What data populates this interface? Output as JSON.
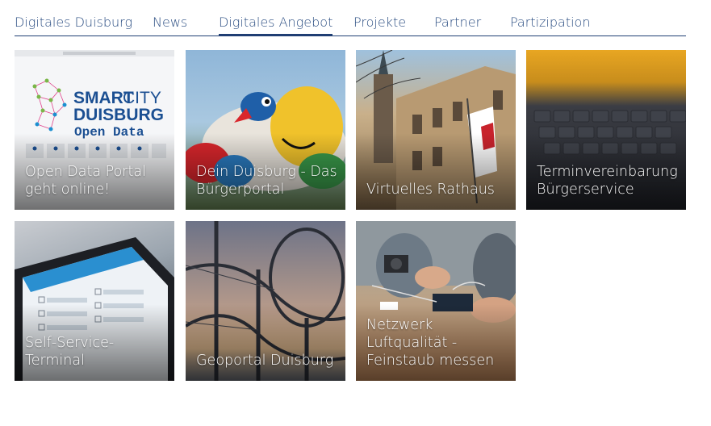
{
  "nav": {
    "items": [
      {
        "label": "Digitales Duisburg"
      },
      {
        "label": "News"
      },
      {
        "label": "Digitales Angebot"
      },
      {
        "label": "Projekte"
      },
      {
        "label": "Partner"
      },
      {
        "label": "Partizipation"
      }
    ],
    "active_index": 2
  },
  "tiles": [
    {
      "label": "Open Data Portal geht online!",
      "image": "smartcity-open-data-screenshot"
    },
    {
      "label": "Dein Duisburg - Das Bürgerportal",
      "image": "colorful-bird-sculpture"
    },
    {
      "label": "Virtuelles Rathaus",
      "image": "town-hall-with-flag"
    },
    {
      "label": "Terminvereinbarung Bürgerservice",
      "image": "laptop-keyboard"
    },
    {
      "label": "Self-Service-Terminal",
      "image": "tablet-form"
    },
    {
      "label": "Geoportal Duisburg",
      "image": "tiger-and-turtle-rollercoaster"
    },
    {
      "label": "Netzwerk Luftqualität - Feinstaub messen",
      "image": "sensor-electronics-workshop"
    }
  ],
  "open_data_logo": {
    "line1_a": "SMART",
    "line1_b": "CITY",
    "line2": "DUISBURG",
    "line3": "Open Data"
  },
  "colors": {
    "nav_text": "#2a4d82",
    "nav_rule": "#1f3e73",
    "logo_blue": "#1b4f92"
  }
}
